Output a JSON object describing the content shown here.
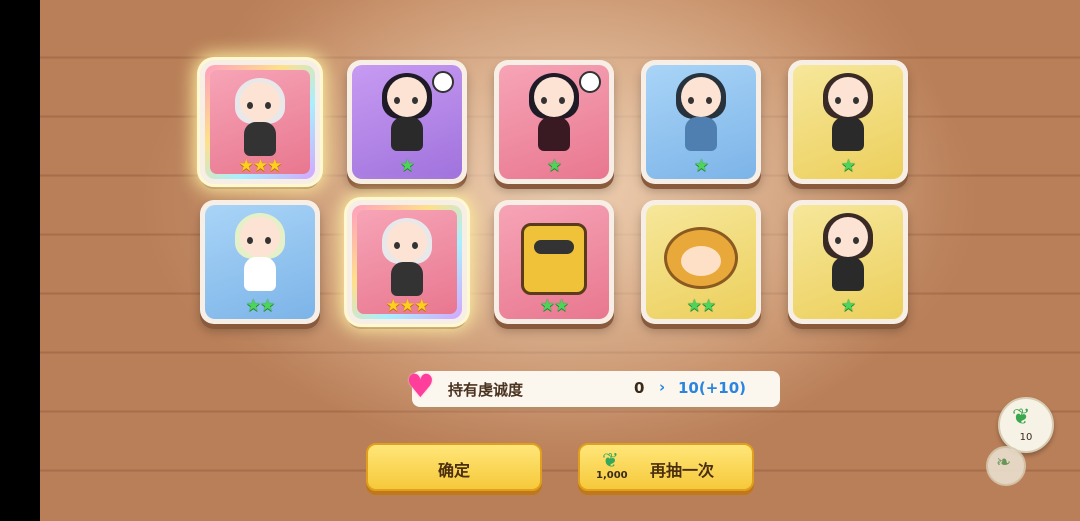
{
  "cards": [
    {
      "bg": "rainbow",
      "stars": "★★★",
      "star_color": "gold",
      "hair": "#e8e8ea",
      "outfit": "#333333",
      "highlight": true
    },
    {
      "bg": "purple",
      "stars": "★",
      "star_color": "green",
      "hair": "#1e1a26",
      "outfit": "#2a2a2a",
      "highlight": false
    },
    {
      "bg": "pink",
      "stars": "★",
      "star_color": "green",
      "hair": "#1e1a26",
      "outfit": "#3a1a22",
      "highlight": false
    },
    {
      "bg": "blue",
      "stars": "★",
      "star_color": "green",
      "hair": "#27323c",
      "outfit": "#4e7fb0",
      "highlight": false
    },
    {
      "bg": "yellow",
      "stars": "★",
      "star_color": "green",
      "hair": "#3a2a26",
      "outfit": "#2a2a2a",
      "highlight": false
    },
    {
      "bg": "blue",
      "stars": "★★",
      "star_color": "green",
      "hair": "#e6f0c8",
      "outfit": "#ffffff",
      "highlight": false
    },
    {
      "bg": "rainbow",
      "stars": "★★★",
      "star_color": "gold",
      "hair": "#e8e8ea",
      "outfit": "#333333",
      "highlight": true
    },
    {
      "bg": "pink",
      "stars": "★★",
      "star_color": "green",
      "hair": "robot",
      "outfit": "",
      "highlight": false
    },
    {
      "bg": "yellow",
      "stars": "★★",
      "star_color": "green",
      "hair": "bee",
      "outfit": "",
      "highlight": false
    },
    {
      "bg": "yellow",
      "stars": "★",
      "star_color": "green",
      "hair": "#3a2a26",
      "outfit": "#2a2a2a",
      "highlight": false
    }
  ],
  "loyalty": {
    "label": "持有虔诚度",
    "from": "0",
    "arrow": "›",
    "to": "10(+10)"
  },
  "buttons": {
    "confirm": "确定",
    "draw_again": "再抽一次",
    "draw_cost": "1,000"
  },
  "side": {
    "count": "10"
  },
  "icons": {
    "heart": "heart-icon",
    "leaf": "leaf-currency-icon"
  }
}
